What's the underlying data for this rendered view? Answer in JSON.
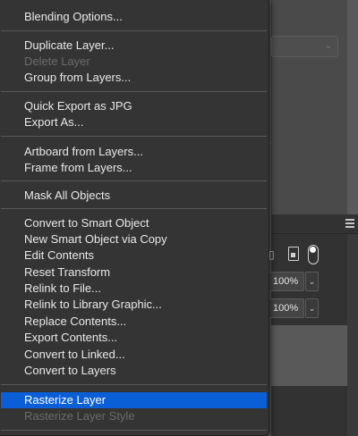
{
  "context_menu": {
    "items": [
      {
        "label": "Blending Options...",
        "state": "enabled"
      },
      {
        "label": "Duplicate Layer...",
        "state": "enabled"
      },
      {
        "label": "Delete Layer",
        "state": "disabled"
      },
      {
        "label": "Group from Layers...",
        "state": "enabled"
      },
      {
        "label": "Quick Export as JPG",
        "state": "enabled"
      },
      {
        "label": "Export As...",
        "state": "enabled"
      },
      {
        "label": "Artboard from Layers...",
        "state": "enabled"
      },
      {
        "label": "Frame from Layers...",
        "state": "enabled"
      },
      {
        "label": "Mask All Objects",
        "state": "enabled"
      },
      {
        "label": "Convert to Smart Object",
        "state": "enabled"
      },
      {
        "label": "New Smart Object via Copy",
        "state": "enabled"
      },
      {
        "label": "Edit Contents",
        "state": "enabled"
      },
      {
        "label": "Reset Transform",
        "state": "enabled"
      },
      {
        "label": "Relink to File...",
        "state": "enabled"
      },
      {
        "label": "Relink to Library Graphic...",
        "state": "enabled"
      },
      {
        "label": "Replace Contents...",
        "state": "enabled"
      },
      {
        "label": "Export Contents...",
        "state": "enabled"
      },
      {
        "label": "Convert to Linked...",
        "state": "enabled"
      },
      {
        "label": "Convert to Layers",
        "state": "enabled"
      },
      {
        "label": "Rasterize Layer",
        "state": "highlighted"
      },
      {
        "label": "Rasterize Layer Style",
        "state": "disabled"
      }
    ]
  },
  "layers_panel": {
    "opacity": "100%",
    "fill": "100%"
  },
  "colors": {
    "highlight": "#0b5fd6",
    "menu_bg": "#343434",
    "disabled_text": "#6b6b6b"
  },
  "icons": {
    "panel_menu": "hamburger-menu-icon",
    "frame": "frame-icon",
    "new_layer": "new-document-icon",
    "lock_toggle": "toggle-icon",
    "dropdown": "chevron-down-icon"
  }
}
